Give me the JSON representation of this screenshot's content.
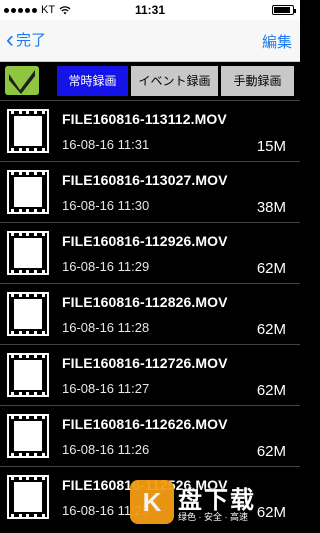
{
  "status": {
    "carrier": "KT",
    "time": "11:31",
    "battery_level": 0.9,
    "wifi_icon": "wifi-icon"
  },
  "nav": {
    "back_label": "完了",
    "edit_label": "編集"
  },
  "tabs": [
    {
      "label": "常時録画",
      "active": true
    },
    {
      "label": "イベント録画",
      "active": false
    },
    {
      "label": "手動録画",
      "active": false
    }
  ],
  "files": [
    {
      "name": "FILE160816-113112.MOV",
      "date": "16-08-16 11:31",
      "size": "15M"
    },
    {
      "name": "FILE160816-113027.MOV",
      "date": "16-08-16 11:30",
      "size": "38M"
    },
    {
      "name": "FILE160816-112926.MOV",
      "date": "16-08-16 11:29",
      "size": "62M"
    },
    {
      "name": "FILE160816-112826.MOV",
      "date": "16-08-16 11:28",
      "size": "62M"
    },
    {
      "name": "FILE160816-112726.MOV",
      "date": "16-08-16 11:27",
      "size": "62M"
    },
    {
      "name": "FILE160816-112626.MOV",
      "date": "16-08-16 11:26",
      "size": "62M"
    },
    {
      "name": "FILE160816-112526.MOV",
      "date": "16-08-16 11:25",
      "size": "62M"
    }
  ],
  "watermark": {
    "badge": "K",
    "title": "盘下载",
    "subtitle": "绿色 · 安全 · 高速"
  },
  "colors": {
    "accent": "#1a7cf5",
    "tab_active": "#1414e8",
    "tab_inactive": "#c8c8c8",
    "logo": "#8ec63f"
  }
}
